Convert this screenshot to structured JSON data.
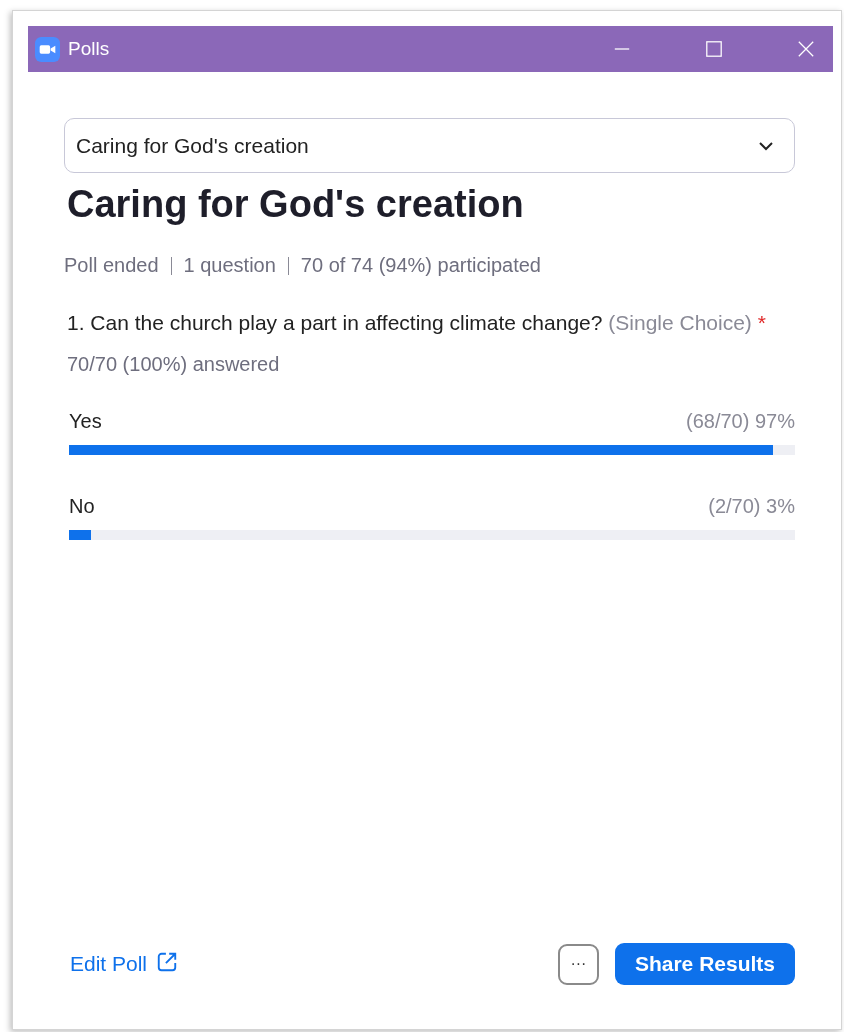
{
  "window": {
    "title": "Polls"
  },
  "poll_selector": {
    "value": "Caring for God's creation"
  },
  "poll_title": "Caring for God's creation",
  "meta": [
    "Poll ended",
    "1 question",
    "70 of 74 (94%) participated"
  ],
  "question": {
    "text": "1. Can the church play a part in affecting climate change?",
    "type": "(Single Choice)",
    "required_mark": "*",
    "answered": "70/70 (100%) answered"
  },
  "answers": [
    {
      "label": "Yes",
      "result": "(68/70) 97%",
      "level": 0.97
    },
    {
      "label": "No",
      "result": "(2/70) 3%",
      "level": 0.03
    }
  ],
  "footer": {
    "edit_link": "Edit Poll",
    "more_button": "···",
    "share_button": "Share Results"
  }
}
